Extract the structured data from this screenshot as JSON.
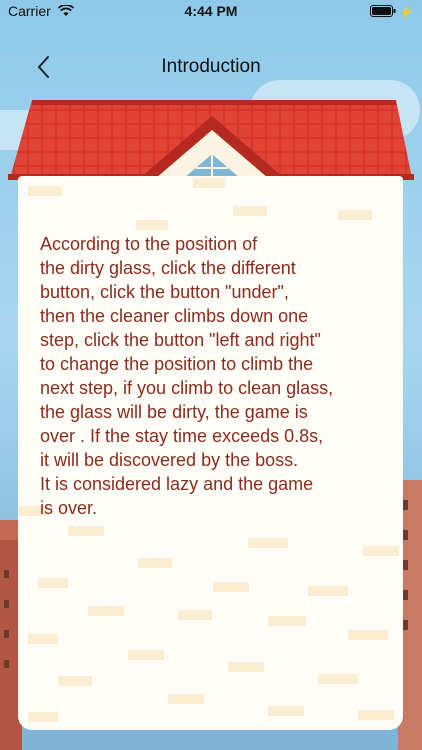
{
  "status_bar": {
    "carrier": "Carrier",
    "time": "4:44 PM",
    "wifi_icon": "wifi-icon",
    "battery_icon": "battery-icon"
  },
  "nav": {
    "title": "Introduction",
    "back_icon": "chevron-left-icon"
  },
  "intro": {
    "text": "According to the position of\nthe dirty glass, click the different\nbutton, click the button \"under\",\nthen the cleaner climbs down one\nstep, click the button \"left and right\"\nto change the position to climb the\nnext step, if you climb to clean glass,\nthe glass will be dirty, the game is\nover . If the stay time exceeds 0.8s,\nit will be discovered by the boss.\nIt is considered lazy and the game\nis over."
  },
  "colors": {
    "roof": "#d9362b",
    "text": "#8a2d1f",
    "card": "#fffdf8",
    "sky": "#9fd0ec"
  }
}
